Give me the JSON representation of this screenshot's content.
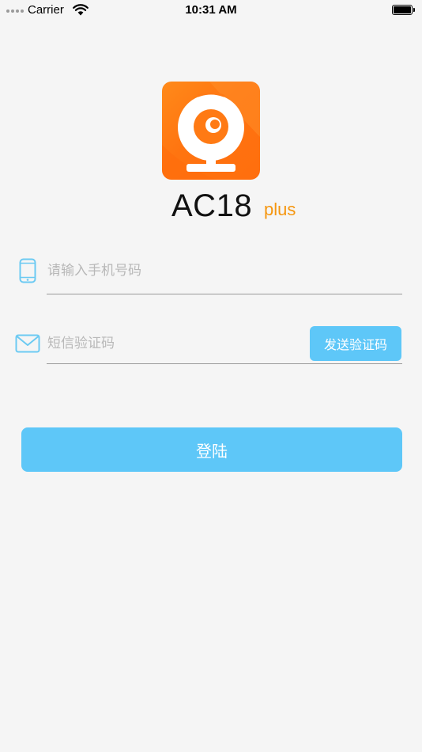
{
  "status_bar": {
    "carrier": "Carrier",
    "time": "10:31 AM"
  },
  "app": {
    "name": "AC18",
    "suffix": "plus"
  },
  "form": {
    "phone_placeholder": "请输入手机号码",
    "code_placeholder": "短信验证码",
    "send_code_label": "发送验证码",
    "login_label": "登陆"
  },
  "colors": {
    "accent": "#5ec7f8",
    "brand_orange": "#ff7410",
    "suffix_orange": "#f5960f",
    "icon_blue": "#6ccaf2"
  },
  "icons": {
    "logo": "webcam-icon",
    "phone_field": "mobile-phone-icon",
    "code_field": "envelope-icon"
  }
}
